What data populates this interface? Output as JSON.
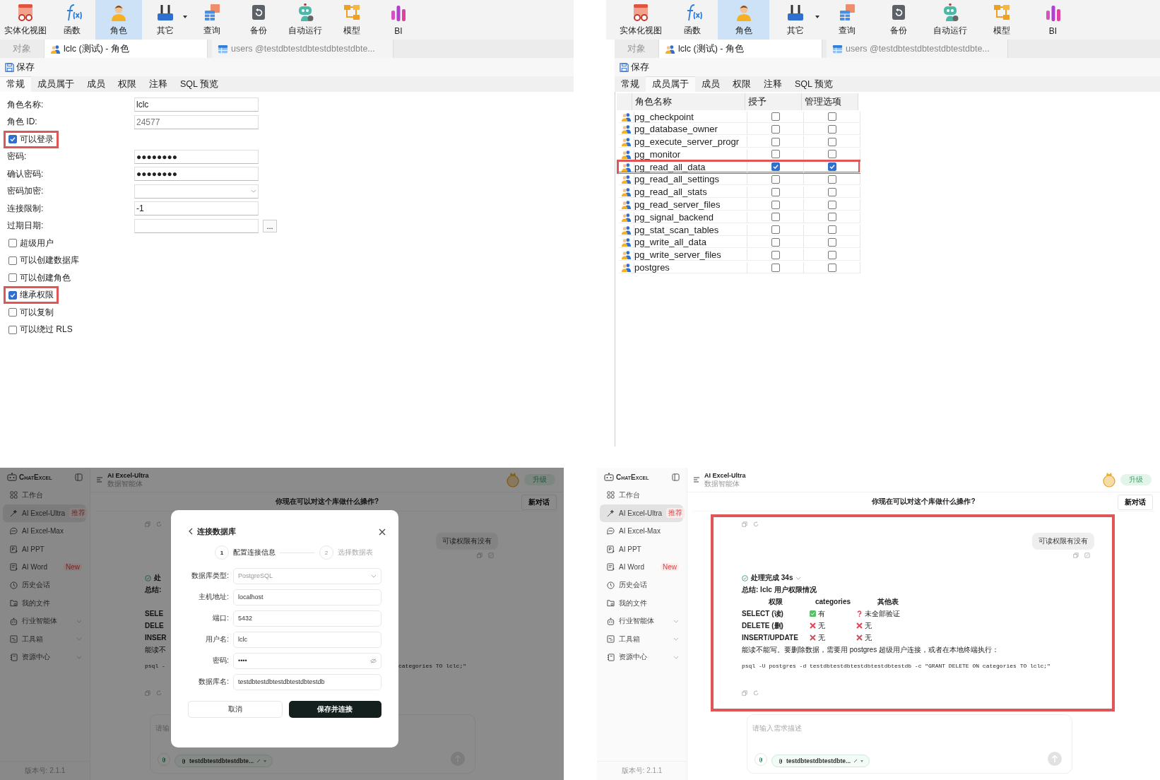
{
  "top_left": {
    "toolbar": [
      {
        "label": "实体化视图",
        "kind": "materialized-view",
        "selected": false,
        "dropdown": false
      },
      {
        "label": "函数",
        "kind": "function",
        "selected": false,
        "dropdown": false
      },
      {
        "label": "角色",
        "kind": "role",
        "selected": true,
        "dropdown": false
      },
      {
        "label": "其它",
        "kind": "other",
        "selected": false,
        "dropdown": true
      },
      {
        "label": "查询",
        "kind": "query",
        "selected": false,
        "dropdown": false
      },
      {
        "label": "备份",
        "kind": "backup",
        "selected": false,
        "dropdown": false
      },
      {
        "label": "自动运行",
        "kind": "automation",
        "selected": false,
        "dropdown": false
      },
      {
        "label": "模型",
        "kind": "model",
        "selected": false,
        "dropdown": false
      },
      {
        "label": "BI",
        "kind": "bi",
        "selected": false,
        "dropdown": false
      }
    ],
    "tabs": [
      {
        "label": "对象",
        "selected": false
      },
      {
        "label": "lclc (测试) - 角色",
        "selected": true,
        "kind": "role"
      },
      {
        "label": "users @testdbtestdbtestdbtestdbte...",
        "selected": false,
        "kind": "table"
      }
    ],
    "save_button": "保存",
    "subtabs": [
      {
        "label": "常规",
        "selected": true
      },
      {
        "label": "成员属于",
        "selected": false
      },
      {
        "label": "成员",
        "selected": false
      },
      {
        "label": "权限",
        "selected": false
      },
      {
        "label": "注释",
        "selected": false
      },
      {
        "label": "SQL 预览",
        "selected": false
      }
    ],
    "form": [
      {
        "kind": "text",
        "label": "角色名称:",
        "value": "lclc"
      },
      {
        "kind": "readonly",
        "label": "角色 ID:",
        "value": "24577"
      },
      {
        "kind": "checkbox",
        "label": "可以登录",
        "checked": true,
        "highlighted": true
      },
      {
        "kind": "text",
        "label": "密码:",
        "value": "●●●●●●●●"
      },
      {
        "kind": "text",
        "label": "确认密码:",
        "value": "●●●●●●●●"
      },
      {
        "kind": "select",
        "label": "密码加密:"
      },
      {
        "kind": "text",
        "label": "连接限制:",
        "value": "-1"
      },
      {
        "kind": "date",
        "label": "过期日期:",
        "button": "..."
      },
      {
        "kind": "checkbox",
        "label": "超级用户",
        "checked": false,
        "highlighted": false
      },
      {
        "kind": "checkbox",
        "label": "可以创建数据库",
        "checked": false,
        "highlighted": false
      },
      {
        "kind": "checkbox",
        "label": "可以创建角色",
        "checked": false,
        "highlighted": false
      },
      {
        "kind": "checkbox",
        "label": "继承权限",
        "checked": true,
        "highlighted": true
      },
      {
        "kind": "checkbox",
        "label": "可以复制",
        "checked": false,
        "highlighted": false
      },
      {
        "kind": "checkbox",
        "label": "可以绕过 RLS",
        "checked": false,
        "highlighted": false
      }
    ]
  },
  "top_right": {
    "toolbar": [
      {
        "label": "实体化视图",
        "kind": "materialized-view",
        "selected": false,
        "dropdown": false
      },
      {
        "label": "函数",
        "kind": "function",
        "selected": false,
        "dropdown": false
      },
      {
        "label": "角色",
        "kind": "role",
        "selected": true,
        "dropdown": false
      },
      {
        "label": "其它",
        "kind": "other",
        "selected": false,
        "dropdown": true
      },
      {
        "label": "查询",
        "kind": "query",
        "selected": false,
        "dropdown": false
      },
      {
        "label": "备份",
        "kind": "backup",
        "selected": false,
        "dropdown": false
      },
      {
        "label": "自动运行",
        "kind": "automation",
        "selected": false,
        "dropdown": false
      },
      {
        "label": "模型",
        "kind": "model",
        "selected": false,
        "dropdown": false
      },
      {
        "label": "BI",
        "kind": "bi",
        "selected": false,
        "dropdown": false
      }
    ],
    "tabs": [
      {
        "label": "对象",
        "selected": false
      },
      {
        "label": "lclc (测试) - 角色",
        "selected": true,
        "kind": "role"
      },
      {
        "label": "users @testdbtestdbtestdbtestdbte...",
        "selected": false,
        "kind": "table"
      }
    ],
    "save_button": "保存",
    "subtabs": [
      {
        "label": "常规",
        "selected": false
      },
      {
        "label": "成员属于",
        "selected": true
      },
      {
        "label": "成员",
        "selected": false
      },
      {
        "label": "权限",
        "selected": false
      },
      {
        "label": "注释",
        "selected": false
      },
      {
        "label": "SQL 预览",
        "selected": false
      }
    ],
    "table": {
      "columns": [
        "角色名称",
        "授予",
        "管理选项"
      ],
      "rows": [
        {
          "name": "pg_checkpoint",
          "granted": false,
          "admin": false,
          "highlighted": false
        },
        {
          "name": "pg_database_owner",
          "granted": false,
          "admin": false,
          "highlighted": false
        },
        {
          "name": "pg_execute_server_progr",
          "granted": false,
          "admin": false,
          "highlighted": false
        },
        {
          "name": "pg_monitor",
          "granted": false,
          "admin": false,
          "highlighted": false
        },
        {
          "name": "pg_read_all_data",
          "granted": true,
          "admin": true,
          "highlighted": true
        },
        {
          "name": "pg_read_all_settings",
          "granted": false,
          "admin": false,
          "highlighted": false
        },
        {
          "name": "pg_read_all_stats",
          "granted": false,
          "admin": false,
          "highlighted": false
        },
        {
          "name": "pg_read_server_files",
          "granted": false,
          "admin": false,
          "highlighted": false
        },
        {
          "name": "pg_signal_backend",
          "granted": false,
          "admin": false,
          "highlighted": false
        },
        {
          "name": "pg_stat_scan_tables",
          "granted": false,
          "admin": false,
          "highlighted": false
        },
        {
          "name": "pg_write_all_data",
          "granted": false,
          "admin": false,
          "highlighted": false
        },
        {
          "name": "pg_write_server_files",
          "granted": false,
          "admin": false,
          "highlighted": false
        },
        {
          "name": "postgres",
          "granted": false,
          "admin": false,
          "highlighted": false
        }
      ]
    }
  },
  "bottom_left": {
    "sidebar": {
      "brand": "ChatExcel",
      "items": [
        {
          "label": "工作台",
          "kind": "workspace",
          "selected": false,
          "expandable": false
        },
        {
          "label": "AI Excel-Ultra",
          "kind": "ultra",
          "selected": true,
          "expandable": false,
          "badge": "推荐"
        },
        {
          "label": "AI Excel-Max",
          "kind": "max",
          "selected": false,
          "expandable": false
        },
        {
          "label": "AI PPT",
          "kind": "ppt",
          "selected": false,
          "expandable": false
        },
        {
          "label": "AI Word",
          "kind": "word",
          "selected": false,
          "expandable": false,
          "badge": "New"
        },
        {
          "label": "历史会话",
          "kind": "history",
          "selected": false,
          "expandable": false
        },
        {
          "label": "我的文件",
          "kind": "files",
          "selected": false,
          "expandable": false
        },
        {
          "label": "行业智能体",
          "kind": "agents",
          "selected": false,
          "expandable": true
        },
        {
          "label": "工具箱",
          "kind": "toolbox",
          "selected": false,
          "expandable": true
        },
        {
          "label": "资源中心",
          "kind": "resources",
          "selected": false,
          "expandable": true
        }
      ],
      "version": "版本号: 2.1.1"
    },
    "header": {
      "title": "AI Excel-Ultra",
      "subtitle": "数据智能体",
      "upgrade_button": "升级"
    },
    "conversation": {
      "title": "你现在可以对这个库做什么操作?",
      "new_chat_button": "新对话",
      "highlighted": false,
      "user_message": "可读权限有没有",
      "fragments": {
        "status": "处",
        "summary": "总结:",
        "rows": [
          "SELE",
          "DELE",
          "INSER"
        ],
        "note": "能读不",
        "command_start": "psql -",
        "command_end": "categories TO lclc;\""
      }
    },
    "composer": {
      "placeholder": "请输",
      "attachment_chip": "testdbtestdbtestdbte..."
    },
    "modal": {
      "title": "连接数据库",
      "steps": [
        {
          "number": "1",
          "label": "配置连接信息",
          "selected": true
        },
        {
          "number": "2",
          "label": "选择数据表",
          "selected": false
        }
      ],
      "fields": [
        {
          "kind": "select",
          "label": "数据库类型:",
          "placeholder": "PostgreSQL"
        },
        {
          "kind": "text",
          "label": "主机地址:",
          "value": "localhost"
        },
        {
          "kind": "text",
          "label": "端口:",
          "value": "5432"
        },
        {
          "kind": "text",
          "label": "用户名:",
          "value": "lclc"
        },
        {
          "kind": "password",
          "label": "密码:",
          "value": "••••"
        },
        {
          "kind": "text",
          "label": "数据库名:",
          "value": "testdbtestdbtestdbtestdbtestdb"
        }
      ],
      "cancel_button": "取消",
      "submit_button": "保存并连接"
    }
  },
  "bottom_right": {
    "sidebar": {
      "brand": "ChatExcel",
      "items": [
        {
          "label": "工作台",
          "kind": "workspace",
          "selected": false,
          "expandable": false
        },
        {
          "label": "AI Excel-Ultra",
          "kind": "ultra",
          "selected": true,
          "expandable": false,
          "badge": "推荐"
        },
        {
          "label": "AI Excel-Max",
          "kind": "max",
          "selected": false,
          "expandable": false
        },
        {
          "label": "AI PPT",
          "kind": "ppt",
          "selected": false,
          "expandable": false
        },
        {
          "label": "AI Word",
          "kind": "word",
          "selected": false,
          "expandable": false,
          "badge": "New"
        },
        {
          "label": "历史会话",
          "kind": "history",
          "selected": false,
          "expandable": false
        },
        {
          "label": "我的文件",
          "kind": "files",
          "selected": false,
          "expandable": false
        },
        {
          "label": "行业智能体",
          "kind": "agents",
          "selected": false,
          "expandable": true
        },
        {
          "label": "工具箱",
          "kind": "toolbox",
          "selected": false,
          "expandable": true
        },
        {
          "label": "资源中心",
          "kind": "resources",
          "selected": false,
          "expandable": true
        }
      ],
      "version": "版本号: 2.1.1"
    },
    "header": {
      "title": "AI Excel-Ultra",
      "subtitle": "数据智能体",
      "upgrade_button": "升级"
    },
    "conversation": {
      "title": "你现在可以对这个库做什么操作?",
      "new_chat_button": "新对话",
      "highlighted": true,
      "user_message": "可读权限有没有",
      "status": "处理完成 34s",
      "summary": "总结: lclc 用户权限情况",
      "table": {
        "columns": [
          "权限",
          "categories",
          "其他表"
        ],
        "rows": [
          {
            "cells": [
              {
                "kind": "label",
                "text": "SELECT (读)"
              },
              {
                "kind": "yes",
                "text": "有"
              },
              {
                "kind": "unknown",
                "text": "未全部验证"
              }
            ]
          },
          {
            "cells": [
              {
                "kind": "label",
                "text": "DELETE (删)"
              },
              {
                "kind": "no",
                "text": "无"
              },
              {
                "kind": "no",
                "text": "无"
              }
            ]
          },
          {
            "cells": [
              {
                "kind": "label",
                "text": "INSERT/UPDATE"
              },
              {
                "kind": "no",
                "text": "无"
              },
              {
                "kind": "no",
                "text": "无"
              }
            ]
          }
        ]
      },
      "note": "能读不能写。要删除数据，需要用 postgres 超级用户连接，或者在本地终端执行：",
      "command": "psql -U postgres -d testdbtestdbtestdbtestdbtestdb -c \"GRANT DELETE ON categories TO lclc;\""
    },
    "composer": {
      "placeholder": "请输入需求描述",
      "attachment_chip": "testdbtestdbtestdbte..."
    }
  }
}
